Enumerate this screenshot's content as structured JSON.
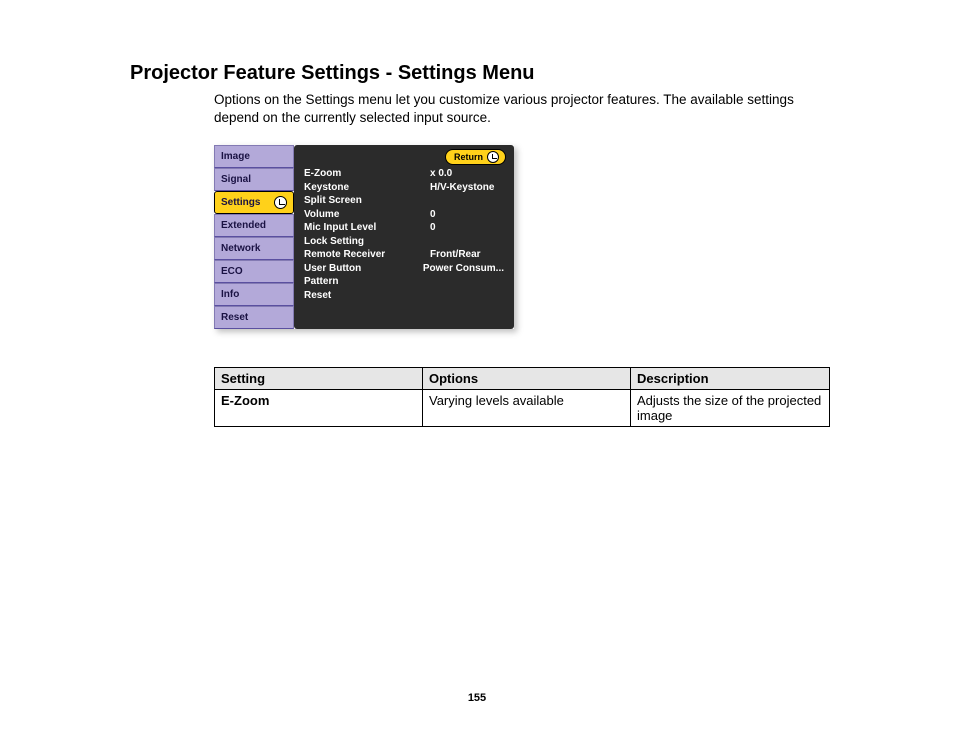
{
  "title": "Projector Feature Settings - Settings Menu",
  "intro": "Options on the Settings menu let you customize various projector features. The available settings depend on the currently selected input source.",
  "osd": {
    "return_label": "Return",
    "sidebar": [
      {
        "label": "Image",
        "selected": false
      },
      {
        "label": "Signal",
        "selected": false
      },
      {
        "label": "Settings",
        "selected": true
      },
      {
        "label": "Extended",
        "selected": false
      },
      {
        "label": "Network",
        "selected": false
      },
      {
        "label": "ECO",
        "selected": false
      },
      {
        "label": "Info",
        "selected": false
      },
      {
        "label": "Reset",
        "selected": false
      }
    ],
    "rows": [
      {
        "label": "E-Zoom",
        "value": "x  0.0"
      },
      {
        "label": "Keystone",
        "value": "H/V-Keystone"
      },
      {
        "label": "Split Screen",
        "value": ""
      },
      {
        "label": "Volume",
        "value": "0"
      },
      {
        "label": "Mic Input Level",
        "value": "0"
      },
      {
        "label": "Lock Setting",
        "value": ""
      },
      {
        "label": "Remote Receiver",
        "value": "Front/Rear"
      },
      {
        "label": "User Button",
        "value": "Power Consum..."
      },
      {
        "label": "Pattern",
        "value": ""
      },
      {
        "label": "Reset",
        "value": ""
      }
    ]
  },
  "table": {
    "headers": {
      "setting": "Setting",
      "options": "Options",
      "description": "Description"
    },
    "rows": [
      {
        "setting": "E-Zoom",
        "options": "Varying levels available",
        "description": "Adjusts the size of the projected image"
      }
    ]
  },
  "page_number": "155"
}
